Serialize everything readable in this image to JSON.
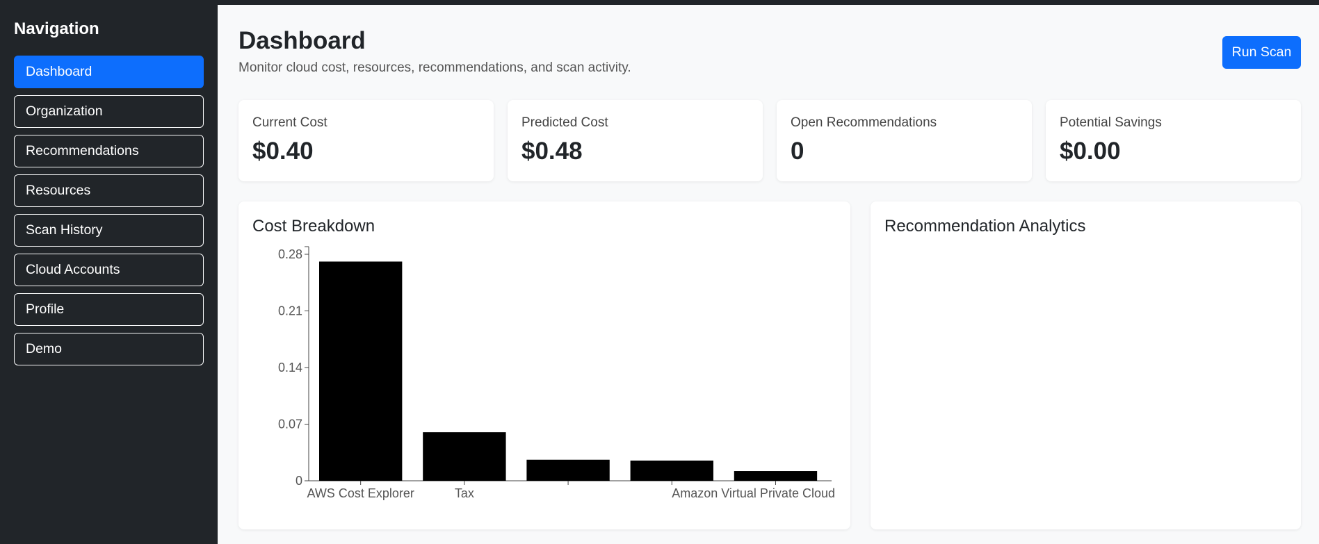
{
  "sidebar": {
    "title": "Navigation",
    "items": [
      {
        "label": "Dashboard"
      },
      {
        "label": "Organization"
      },
      {
        "label": "Recommendations"
      },
      {
        "label": "Resources"
      },
      {
        "label": "Scan History"
      },
      {
        "label": "Cloud Accounts"
      },
      {
        "label": "Profile"
      },
      {
        "label": "Demo"
      }
    ]
  },
  "header": {
    "title": "Dashboard",
    "subtitle": "Monitor cloud cost, resources, recommendations, and scan activity.",
    "run_scan_label": "Run Scan"
  },
  "stats": [
    {
      "label": "Current Cost",
      "value": "$0.40"
    },
    {
      "label": "Predicted Cost",
      "value": "$0.48"
    },
    {
      "label": "Open Recommendations",
      "value": "0"
    },
    {
      "label": "Potential Savings",
      "value": "$0.00"
    }
  ],
  "panels": {
    "cost_breakdown_title": "Cost Breakdown",
    "recommendation_title": "Recommendation Analytics"
  },
  "colors": {
    "accent": "#0d6efd",
    "sidebar": "#212529",
    "bar": "#000000"
  },
  "chart_data": {
    "type": "bar",
    "title": "Cost Breakdown",
    "categories": [
      "AWS Cost Explorer",
      "Tax",
      "",
      "",
      "Amazon Virtual Private Cloud"
    ],
    "values": [
      0.271,
      0.06,
      0.026,
      0.025,
      0.012
    ],
    "yticks": [
      "0",
      "0.07",
      "0.14",
      "0.21",
      "0.28"
    ],
    "ylim": [
      0,
      0.28
    ],
    "grid": false
  }
}
